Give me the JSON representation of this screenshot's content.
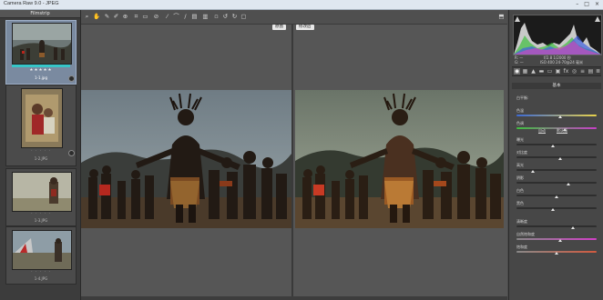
{
  "window": {
    "title": "Camera Raw 9.0  -  JPEG"
  },
  "filmstrip": {
    "header": "Filmstrip",
    "items": [
      {
        "stars": "★★★★★",
        "filename": "1-1.jpg",
        "selected": true,
        "color_label": "#37c6c7"
      },
      {
        "stars": "· · · · ·",
        "filename": "1-2.JPG",
        "selected": false
      },
      {
        "stars": "· · · · ·",
        "filename": "1-3.JPG",
        "selected": false
      },
      {
        "stars": "· · · · ·",
        "filename": "1-4.JPG",
        "selected": false
      }
    ]
  },
  "toolbar": {
    "tools": [
      "zoom-icon",
      "hand-icon",
      "white-balance-icon",
      "color-sampler-icon",
      "targeted-adjust-icon",
      "crop-icon",
      "straighten-icon",
      "spot-removal-icon",
      "red-eye-icon",
      "adjustment-brush-icon",
      "graduated-filter-icon",
      "radial-filter-icon",
      "preferences-icon",
      "rotate-ccw-icon",
      "rotate-cw-icon",
      "trash-icon"
    ],
    "fullscreen_icon": "fullscreen-icon"
  },
  "view": {
    "before_label": "原图",
    "after_label": "修改后"
  },
  "histogram": {
    "readout_line1": "f/2.8   1/2000 秒",
    "readout_line2": "ISO 400   24-70@24 毫米",
    "rgb_labels": [
      "R:",
      "G:",
      "B:"
    ]
  },
  "panel": {
    "title": "基本",
    "auto_link": "自动",
    "default_link": "默认值",
    "sliders": [
      {
        "label": "白平衡:",
        "value": 0.5,
        "track": "none"
      },
      {
        "label": "色温",
        "value": 0.55,
        "track": "temp"
      },
      {
        "label": "色调",
        "value": 0.6,
        "track": "tint"
      },
      {
        "label": "曝光",
        "value": 0.45,
        "track": "gray"
      },
      {
        "label": "对比度",
        "value": 0.55,
        "track": "gray"
      },
      {
        "label": "高光",
        "value": 0.2,
        "track": "gray"
      },
      {
        "label": "阴影",
        "value": 0.65,
        "track": "gray"
      },
      {
        "label": "白色",
        "value": 0.5,
        "track": "gray"
      },
      {
        "label": "黑色",
        "value": 0.45,
        "track": "gray"
      },
      {
        "label": "清晰度",
        "value": 0.7,
        "track": "gray"
      },
      {
        "label": "自然饱和度",
        "value": 0.55,
        "track": "vib"
      },
      {
        "label": "饱和度",
        "value": 0.5,
        "track": "sat"
      }
    ]
  },
  "colors": {
    "accent": "#37c6c7",
    "panel_bg": "#474747",
    "view_bg": "#565656"
  }
}
